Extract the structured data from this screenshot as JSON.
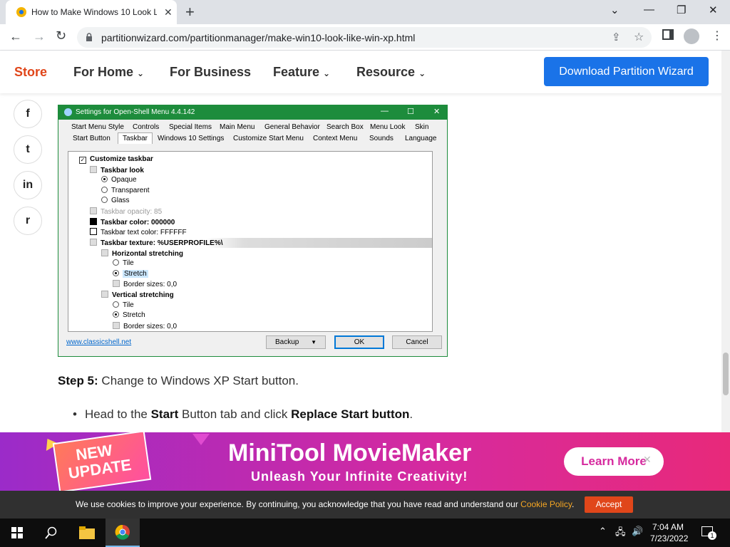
{
  "browser": {
    "tab_title": "How to Make Windows 10 Look L",
    "url": "partitionwizard.com/partitionmanager/make-win10-look-like-win-xp.html"
  },
  "site_nav": {
    "store": "Store",
    "for_home": "For Home",
    "for_business": "For Business",
    "feature": "Feature",
    "resource": "Resource",
    "download_button": "Download Partition Wizard"
  },
  "social": [
    "f",
    "t",
    "in",
    "r"
  ],
  "dialog": {
    "title": "Settings for Open-Shell Menu 4.4.142",
    "tabs_row1": [
      "Start Menu Style",
      "Controls",
      "Special Items",
      "Main Menu",
      "General Behavior",
      "Search Box",
      "Menu Look",
      "Skin"
    ],
    "tabs_row2": [
      "Start Button",
      "Taskbar",
      "Windows 10 Settings",
      "Customize Start Menu",
      "Context Menu",
      "Sounds",
      "Language"
    ],
    "tree": {
      "customize_taskbar": "Customize taskbar",
      "taskbar_look": "Taskbar look",
      "opaque": "Opaque",
      "transparent": "Transparent",
      "glass": "Glass",
      "taskbar_opacity": "Taskbar opacity: 85",
      "taskbar_color": "Taskbar color: 000000",
      "taskbar_text_color": "Taskbar text color: FFFFFF",
      "taskbar_texture": "Taskbar texture: %USERPROFILE%\\",
      "horizontal_stretching": "Horizontal stretching",
      "h_tile": "Tile",
      "h_stretch": "Stretch",
      "h_border": "Border sizes: 0,0",
      "vertical_stretching": "Vertical stretching",
      "v_tile": "Tile",
      "v_stretch": "Stretch",
      "v_border": "Border sizes: 0,0"
    },
    "link": "www.classicshell.net",
    "backup": "Backup",
    "ok": "OK",
    "cancel": "Cancel"
  },
  "article": {
    "step_label": "Step 5:",
    "step_text": " Change to Windows XP Start button.",
    "bullet_pre": "Head to the ",
    "bullet_bold1": "Start",
    "bullet_mid": " Button tab and click ",
    "bullet_bold2": "Replace Start button",
    "bullet_end": "."
  },
  "ad": {
    "badge_line1": "NEW",
    "badge_line2": "UPDATE",
    "title": "MiniTool MovieMaker",
    "subtitle": "Unleash Your Infinite Creativity!",
    "button": "Learn More"
  },
  "cookie": {
    "text": "We use cookies to improve your experience. By continuing, you acknowledge that you have read and understand our ",
    "link": "Cookie Policy",
    "end": ".",
    "accept": "Accept"
  },
  "taskbar": {
    "time": "7:04 AM",
    "date": "7/23/2022",
    "notification_count": "1"
  },
  "colors": {
    "brand_red": "#e0461a",
    "download_blue": "#1a73e8",
    "dialog_green": "#1d8c3c",
    "ad_purple": "#9b2bc9",
    "ad_pink": "#d62a9e"
  }
}
